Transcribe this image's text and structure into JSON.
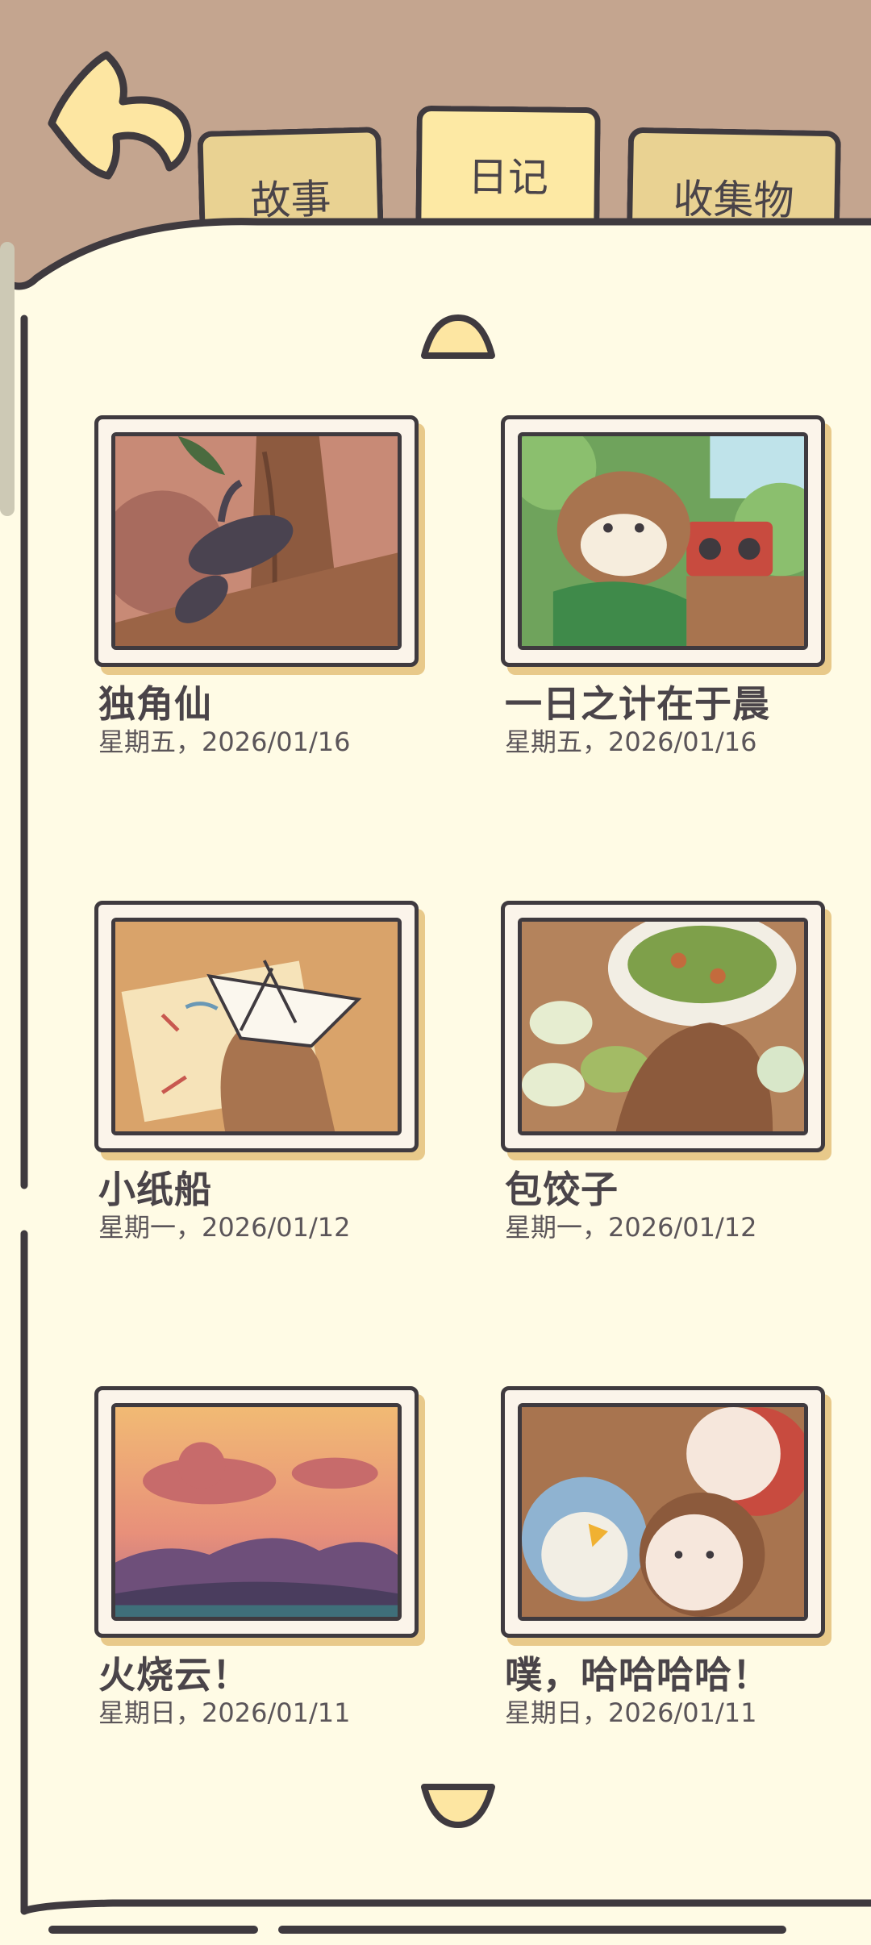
{
  "tabs": [
    {
      "label": "故事",
      "active": false
    },
    {
      "label": "日记",
      "active": true
    },
    {
      "label": "收集物",
      "active": false
    }
  ],
  "entries": [
    {
      "title": "独角仙",
      "date": "星期五，2026/01/16"
    },
    {
      "title": "一日之计在于晨",
      "date": "星期五，2026/01/16"
    },
    {
      "title": "小纸船",
      "date": "星期一，2026/01/12"
    },
    {
      "title": "包饺子",
      "date": "星期一，2026/01/12"
    },
    {
      "title": "火烧云！",
      "date": "星期日，2026/01/11"
    },
    {
      "title": "噗，哈哈哈哈！",
      "date": "星期日，2026/01/11"
    }
  ],
  "icons": {
    "back": "back-arrow-icon",
    "page_up": "chevron-up-icon",
    "page_down": "chevron-down-icon"
  },
  "colors": {
    "page_background": "#fffbe5",
    "frame_background": "#c4a58f",
    "outline": "#3f3a3f",
    "tab_fill": "#e9d292",
    "tab_active_fill": "#fde9a4",
    "button_yellow": "#fde6a2",
    "text": "#4a4449"
  }
}
